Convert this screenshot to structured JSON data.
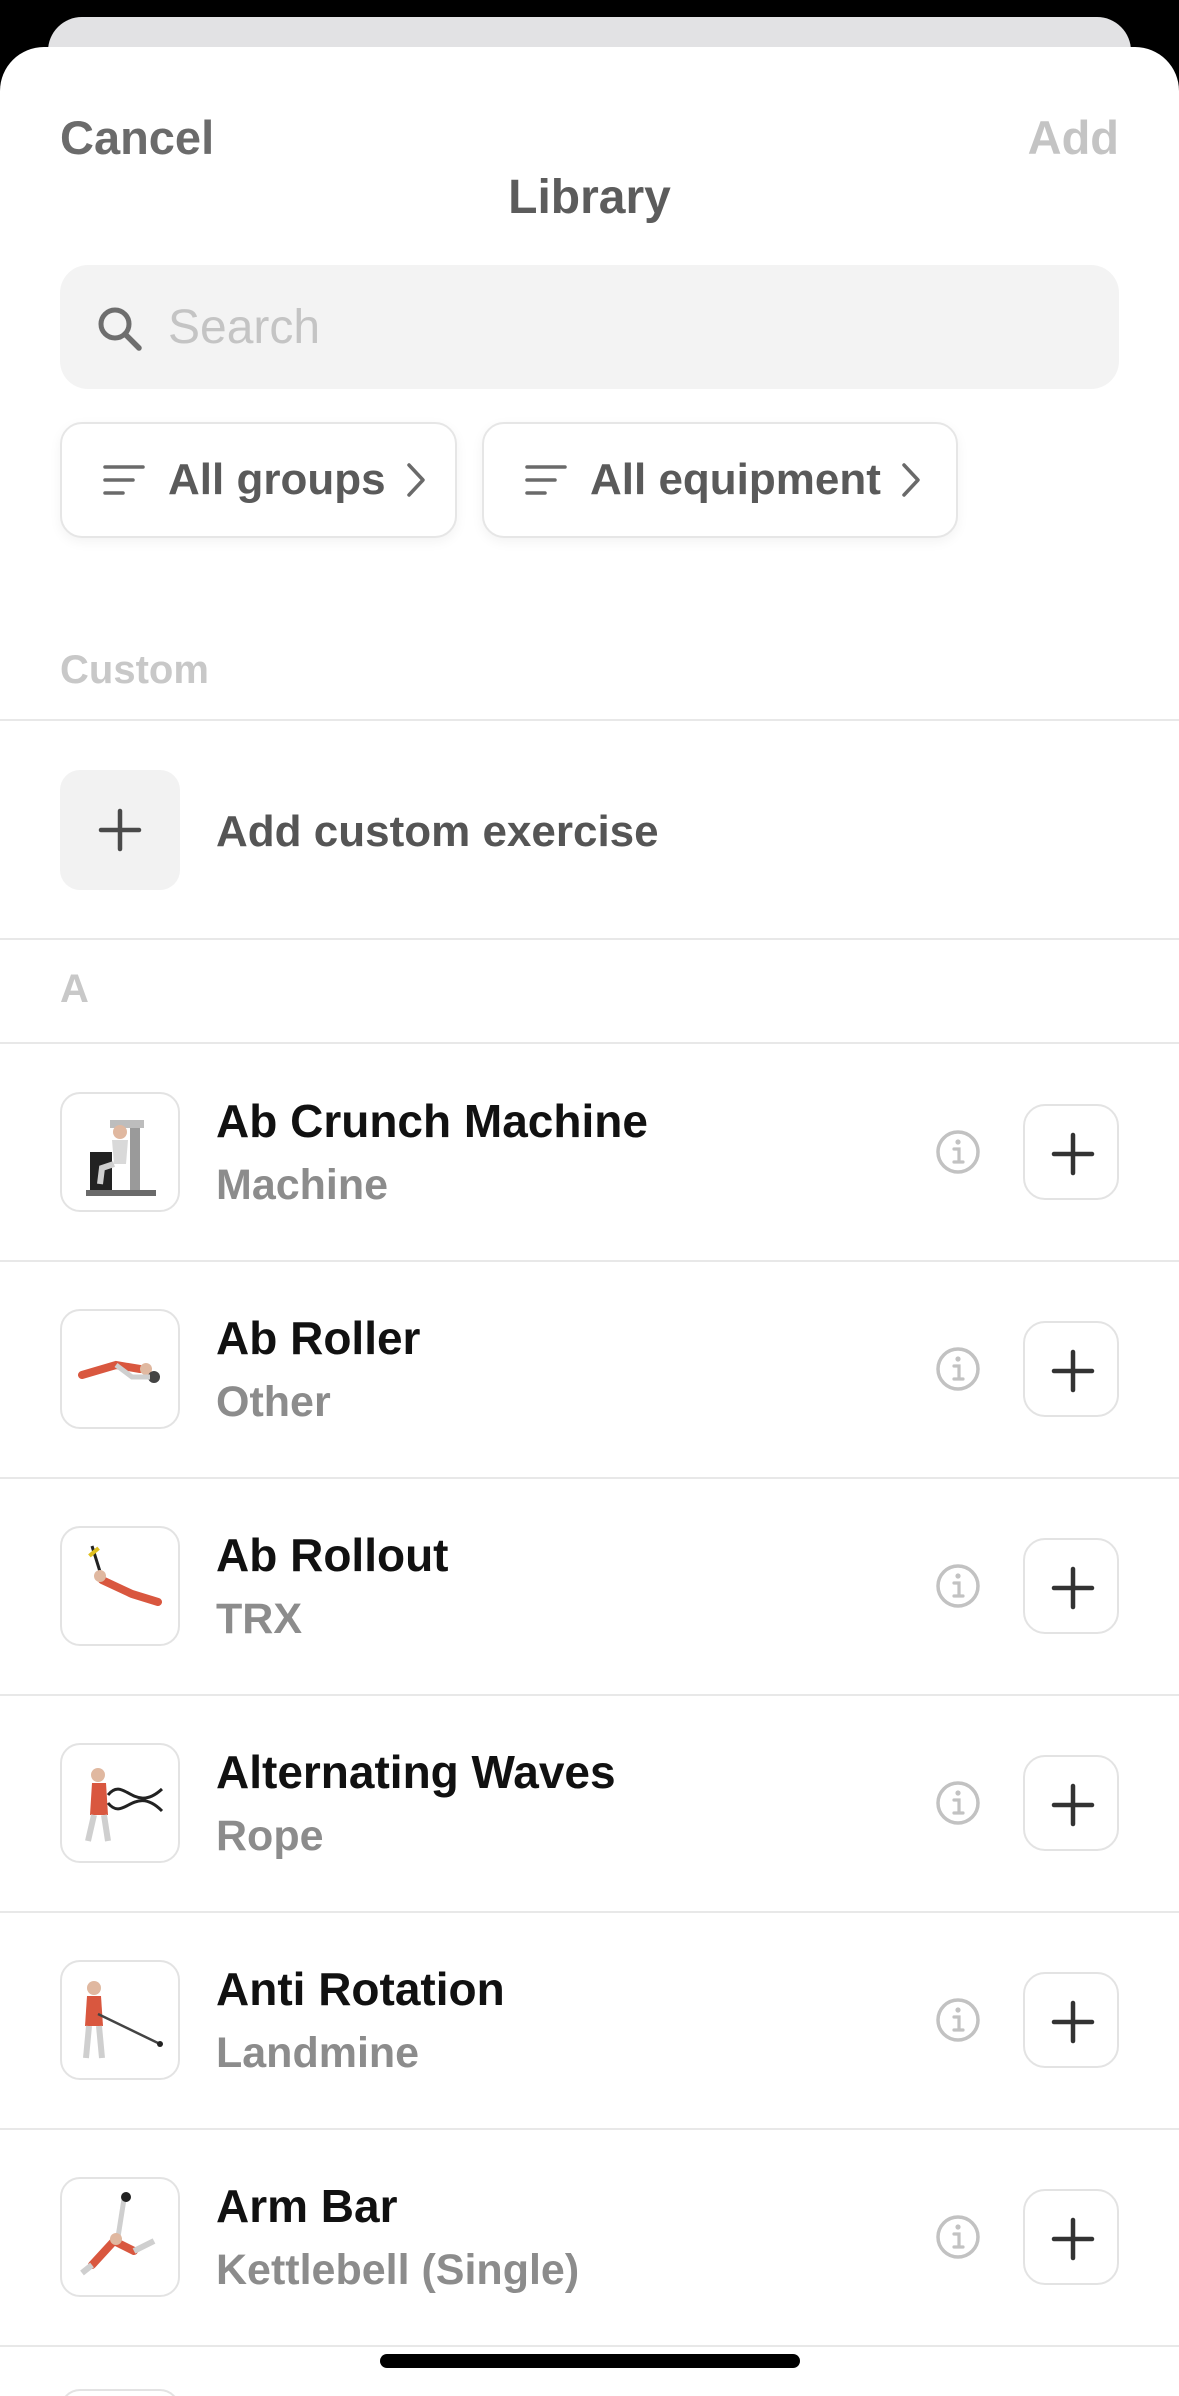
{
  "nav": {
    "cancel_label": "Cancel",
    "title": "Library",
    "add_label": "Add"
  },
  "search": {
    "placeholder": "Search",
    "value": ""
  },
  "filters": {
    "groups_label": "All groups",
    "equipment_label": "All equipment"
  },
  "sections": {
    "custom_label": "Custom",
    "a_label": "A"
  },
  "add_custom": {
    "label": "Add custom exercise"
  },
  "exercises": [
    {
      "name": "Ab Crunch Machine",
      "equipment": "Machine",
      "icon": "ab-crunch-machine-illustration"
    },
    {
      "name": "Ab Roller",
      "equipment": "Other",
      "icon": "ab-roller-illustration"
    },
    {
      "name": "Ab Rollout",
      "equipment": "TRX",
      "icon": "ab-rollout-illustration"
    },
    {
      "name": "Alternating Waves",
      "equipment": "Rope",
      "icon": "alternating-waves-illustration"
    },
    {
      "name": "Anti Rotation",
      "equipment": "Landmine",
      "icon": "anti-rotation-illustration"
    },
    {
      "name": "Arm Bar",
      "equipment": "Kettlebell (Single)",
      "icon": "arm-bar-illustration"
    }
  ],
  "colors": {
    "accent_text": "#111111",
    "muted_text": "#8c8c8c",
    "disabled": "#c4c4c4",
    "muscle": "#d9573f"
  }
}
